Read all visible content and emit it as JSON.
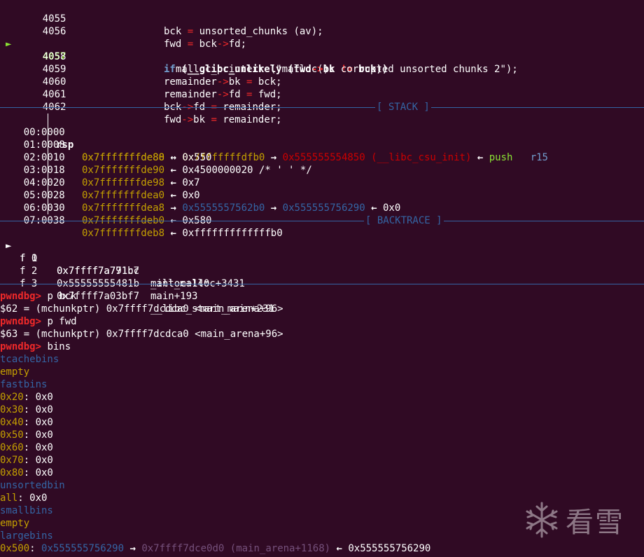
{
  "source": [
    {
      "num": "4055",
      "code": "bck = unsorted_chunks (av);",
      "current": false
    },
    {
      "num": "4056",
      "code": "fwd = bck->fd;",
      "current": false
    },
    {
      "num": "4057",
      "code": "if (__glibc_unlikely (fwd->bk != bck))",
      "current": true
    },
    {
      "num": "4058",
      "code": "  malloc_printerr (\"malloc(): corrupted unsorted chunks 2\");",
      "current": false
    },
    {
      "num": "4059",
      "code": "remainder->bk = bck;",
      "current": false
    },
    {
      "num": "4060",
      "code": "remainder->fd = fwd;",
      "current": false
    },
    {
      "num": "4061",
      "code": "bck->fd = remainder;",
      "current": false
    },
    {
      "num": "4062",
      "code": "fwd->bk = remainder;",
      "current": false
    }
  ],
  "stack": {
    "title": "[ STACK ]",
    "rows": [
      {
        "off": "00:0000",
        "reg": "rsp",
        "addr": "0x7fffffffde80",
        "a1": "→",
        "v1": "0x7fffffffdfb0",
        "a2": "→",
        "v2": "0x555555554850 (__libc_csu_init)",
        "a3": "←",
        "v3": "push",
        "v4": "r15"
      },
      {
        "off": "01:0008",
        "reg": "",
        "addr": "0x7fffffffde88",
        "a1": "←",
        "v1": "0x550"
      },
      {
        "off": "02:0010",
        "reg": "",
        "addr": "0x7fffffffde90",
        "a1": "←",
        "v1": "0x4500000020 /* ' ' */"
      },
      {
        "off": "03:0018",
        "reg": "",
        "addr": "0x7fffffffde98",
        "a1": "←",
        "v1": "0x7"
      },
      {
        "off": "04:0020",
        "reg": "",
        "addr": "0x7fffffffdea0",
        "a1": "←",
        "v1": "0x0"
      },
      {
        "off": "05:0028",
        "reg": "",
        "addr": "0x7fffffffdea8",
        "a1": "→",
        "v1": "0x5555557562b0",
        "a2": "→",
        "v2": "0x555555756290",
        "a3": "←",
        "v3": "0x0"
      },
      {
        "off": "06:0030",
        "reg": "",
        "addr": "0x7fffffffdeb0",
        "a1": "←",
        "v1": "0x580"
      },
      {
        "off": "07:0038",
        "reg": "",
        "addr": "0x7fffffffdeb8",
        "a1": "←",
        "v1": "0xfffffffffffffb0"
      }
    ]
  },
  "backtrace": {
    "title": "[ BACKTRACE ]",
    "frames": [
      {
        "marker": "►",
        "frame": "f 0",
        "addr": "0x7ffff7a771b7",
        "sym": "_int_malloc+3431"
      },
      {
        "marker": "",
        "frame": "f 1",
        "addr": "0x7ffff7a791cc",
        "sym": "malloc+140"
      },
      {
        "marker": "",
        "frame": "f 2",
        "addr": "0x55555555481b",
        "sym": "main+193"
      },
      {
        "marker": "",
        "frame": "f 3",
        "addr": "0x7ffff7a03bf7",
        "sym": "__libc_start_main+231"
      }
    ]
  },
  "session": {
    "prompt": "pwndbg>",
    "cmd1": " p bck",
    "out1": "$62 = (mchunkptr) 0x7ffff7dcdca0 <main_arena+96>",
    "cmd2": " p fwd",
    "out2": "$63 = (mchunkptr) 0x7ffff7dcdca0 <main_arena+96>",
    "cmd3": " bins"
  },
  "bins": {
    "tcache_h": "tcachebins",
    "tcache_v": "empty",
    "fast_h": "fastbins",
    "fast": [
      {
        "size": "0x20",
        "val": ": 0x0"
      },
      {
        "size": "0x30",
        "val": ": 0x0"
      },
      {
        "size": "0x40",
        "val": ": 0x0"
      },
      {
        "size": "0x50",
        "val": ": 0x0"
      },
      {
        "size": "0x60",
        "val": ": 0x0"
      },
      {
        "size": "0x70",
        "val": ": 0x0"
      },
      {
        "size": "0x80",
        "val": ": 0x0"
      }
    ],
    "unsorted_h": "unsortedbin",
    "unsorted_k": "all",
    "unsorted_v": ": 0x0",
    "small_h": "smallbins",
    "small_v": "empty",
    "large_h": "largebins",
    "large_size": "0x500",
    "large_colon": ": ",
    "large_a1": "0x555555756290",
    "large_arr1": " → ",
    "large_a2": "0x7ffff7dce0d0 (main_arena+1168)",
    "large_arr2": " ← ",
    "large_a3": "0x555555756290"
  },
  "watermark": {
    "text": "看雪",
    "icon": "snowflake-icon"
  }
}
